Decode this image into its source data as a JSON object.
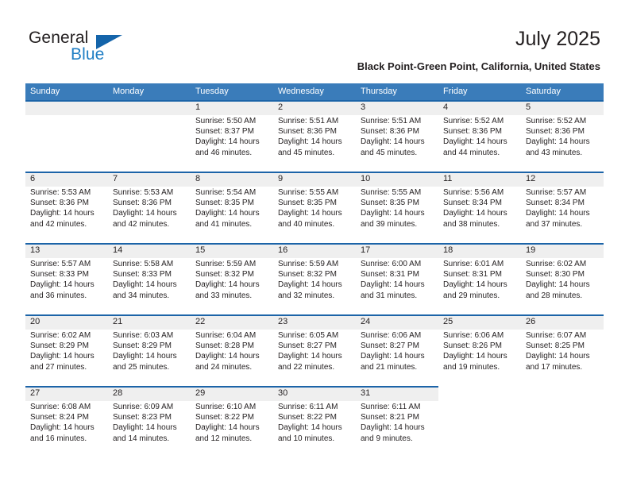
{
  "brand": {
    "name_top": "General",
    "name_bottom": "Blue",
    "triangle_color": "#1464aa",
    "blue_color": "#1f7ec4"
  },
  "header": {
    "title": "July 2025",
    "subtitle": "Black Point-Green Point, California, United States"
  },
  "theme": {
    "header_bg": "#3a7cba",
    "rule_color": "#1c64a8",
    "band_bg": "#efefef",
    "text": "#231f20"
  },
  "calendar": {
    "weekday_headers": [
      "Sunday",
      "Monday",
      "Tuesday",
      "Wednesday",
      "Thursday",
      "Friday",
      "Saturday"
    ],
    "labels": {
      "sunrise": "Sunrise:",
      "sunset": "Sunset:",
      "daylight": "Daylight:"
    },
    "weeks": [
      [
        {
          "day": "",
          "l1": "",
          "l2": "",
          "l3": "",
          "l4": ""
        },
        {
          "day": "",
          "l1": "",
          "l2": "",
          "l3": "",
          "l4": ""
        },
        {
          "day": "1",
          "l1": "Sunrise: 5:50 AM",
          "l2": "Sunset: 8:37 PM",
          "l3": "Daylight: 14 hours",
          "l4": "and 46 minutes."
        },
        {
          "day": "2",
          "l1": "Sunrise: 5:51 AM",
          "l2": "Sunset: 8:36 PM",
          "l3": "Daylight: 14 hours",
          "l4": "and 45 minutes."
        },
        {
          "day": "3",
          "l1": "Sunrise: 5:51 AM",
          "l2": "Sunset: 8:36 PM",
          "l3": "Daylight: 14 hours",
          "l4": "and 45 minutes."
        },
        {
          "day": "4",
          "l1": "Sunrise: 5:52 AM",
          "l2": "Sunset: 8:36 PM",
          "l3": "Daylight: 14 hours",
          "l4": "and 44 minutes."
        },
        {
          "day": "5",
          "l1": "Sunrise: 5:52 AM",
          "l2": "Sunset: 8:36 PM",
          "l3": "Daylight: 14 hours",
          "l4": "and 43 minutes."
        }
      ],
      [
        {
          "day": "6",
          "l1": "Sunrise: 5:53 AM",
          "l2": "Sunset: 8:36 PM",
          "l3": "Daylight: 14 hours",
          "l4": "and 42 minutes."
        },
        {
          "day": "7",
          "l1": "Sunrise: 5:53 AM",
          "l2": "Sunset: 8:36 PM",
          "l3": "Daylight: 14 hours",
          "l4": "and 42 minutes."
        },
        {
          "day": "8",
          "l1": "Sunrise: 5:54 AM",
          "l2": "Sunset: 8:35 PM",
          "l3": "Daylight: 14 hours",
          "l4": "and 41 minutes."
        },
        {
          "day": "9",
          "l1": "Sunrise: 5:55 AM",
          "l2": "Sunset: 8:35 PM",
          "l3": "Daylight: 14 hours",
          "l4": "and 40 minutes."
        },
        {
          "day": "10",
          "l1": "Sunrise: 5:55 AM",
          "l2": "Sunset: 8:35 PM",
          "l3": "Daylight: 14 hours",
          "l4": "and 39 minutes."
        },
        {
          "day": "11",
          "l1": "Sunrise: 5:56 AM",
          "l2": "Sunset: 8:34 PM",
          "l3": "Daylight: 14 hours",
          "l4": "and 38 minutes."
        },
        {
          "day": "12",
          "l1": "Sunrise: 5:57 AM",
          "l2": "Sunset: 8:34 PM",
          "l3": "Daylight: 14 hours",
          "l4": "and 37 minutes."
        }
      ],
      [
        {
          "day": "13",
          "l1": "Sunrise: 5:57 AM",
          "l2": "Sunset: 8:33 PM",
          "l3": "Daylight: 14 hours",
          "l4": "and 36 minutes."
        },
        {
          "day": "14",
          "l1": "Sunrise: 5:58 AM",
          "l2": "Sunset: 8:33 PM",
          "l3": "Daylight: 14 hours",
          "l4": "and 34 minutes."
        },
        {
          "day": "15",
          "l1": "Sunrise: 5:59 AM",
          "l2": "Sunset: 8:32 PM",
          "l3": "Daylight: 14 hours",
          "l4": "and 33 minutes."
        },
        {
          "day": "16",
          "l1": "Sunrise: 5:59 AM",
          "l2": "Sunset: 8:32 PM",
          "l3": "Daylight: 14 hours",
          "l4": "and 32 minutes."
        },
        {
          "day": "17",
          "l1": "Sunrise: 6:00 AM",
          "l2": "Sunset: 8:31 PM",
          "l3": "Daylight: 14 hours",
          "l4": "and 31 minutes."
        },
        {
          "day": "18",
          "l1": "Sunrise: 6:01 AM",
          "l2": "Sunset: 8:31 PM",
          "l3": "Daylight: 14 hours",
          "l4": "and 29 minutes."
        },
        {
          "day": "19",
          "l1": "Sunrise: 6:02 AM",
          "l2": "Sunset: 8:30 PM",
          "l3": "Daylight: 14 hours",
          "l4": "and 28 minutes."
        }
      ],
      [
        {
          "day": "20",
          "l1": "Sunrise: 6:02 AM",
          "l2": "Sunset: 8:29 PM",
          "l3": "Daylight: 14 hours",
          "l4": "and 27 minutes."
        },
        {
          "day": "21",
          "l1": "Sunrise: 6:03 AM",
          "l2": "Sunset: 8:29 PM",
          "l3": "Daylight: 14 hours",
          "l4": "and 25 minutes."
        },
        {
          "day": "22",
          "l1": "Sunrise: 6:04 AM",
          "l2": "Sunset: 8:28 PM",
          "l3": "Daylight: 14 hours",
          "l4": "and 24 minutes."
        },
        {
          "day": "23",
          "l1": "Sunrise: 6:05 AM",
          "l2": "Sunset: 8:27 PM",
          "l3": "Daylight: 14 hours",
          "l4": "and 22 minutes."
        },
        {
          "day": "24",
          "l1": "Sunrise: 6:06 AM",
          "l2": "Sunset: 8:27 PM",
          "l3": "Daylight: 14 hours",
          "l4": "and 21 minutes."
        },
        {
          "day": "25",
          "l1": "Sunrise: 6:06 AM",
          "l2": "Sunset: 8:26 PM",
          "l3": "Daylight: 14 hours",
          "l4": "and 19 minutes."
        },
        {
          "day": "26",
          "l1": "Sunrise: 6:07 AM",
          "l2": "Sunset: 8:25 PM",
          "l3": "Daylight: 14 hours",
          "l4": "and 17 minutes."
        }
      ],
      [
        {
          "day": "27",
          "l1": "Sunrise: 6:08 AM",
          "l2": "Sunset: 8:24 PM",
          "l3": "Daylight: 14 hours",
          "l4": "and 16 minutes."
        },
        {
          "day": "28",
          "l1": "Sunrise: 6:09 AM",
          "l2": "Sunset: 8:23 PM",
          "l3": "Daylight: 14 hours",
          "l4": "and 14 minutes."
        },
        {
          "day": "29",
          "l1": "Sunrise: 6:10 AM",
          "l2": "Sunset: 8:22 PM",
          "l3": "Daylight: 14 hours",
          "l4": "and 12 minutes."
        },
        {
          "day": "30",
          "l1": "Sunrise: 6:11 AM",
          "l2": "Sunset: 8:22 PM",
          "l3": "Daylight: 14 hours",
          "l4": "and 10 minutes."
        },
        {
          "day": "31",
          "l1": "Sunrise: 6:11 AM",
          "l2": "Sunset: 8:21 PM",
          "l3": "Daylight: 14 hours",
          "l4": "and 9 minutes."
        },
        {
          "day": "",
          "l1": "",
          "l2": "",
          "l3": "",
          "l4": ""
        },
        {
          "day": "",
          "l1": "",
          "l2": "",
          "l3": "",
          "l4": ""
        }
      ]
    ]
  }
}
